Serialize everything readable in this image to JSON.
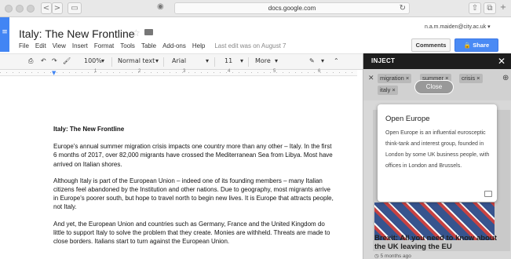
{
  "browser": {
    "url": "docs.google.com",
    "nav_back": "<",
    "nav_forward": ">",
    "reload_glyph": "↻",
    "lock_glyph": "◉"
  },
  "doc": {
    "title": "Italy: The New Frontline",
    "menu": [
      "File",
      "Edit",
      "View",
      "Insert",
      "Format",
      "Tools",
      "Table",
      "Add-ons",
      "Help"
    ],
    "last_edit": "Last edit was on August 7",
    "account": "n.a.m.maiden@city.ac.uk ▾",
    "comments_label": "Comments",
    "share_label": "Share",
    "toolbar": {
      "zoom": "100%",
      "style": "Normal text",
      "font": "Arial",
      "size": "11",
      "more": "More"
    },
    "ruler_numbers": [
      "1",
      "2",
      "3",
      "4",
      "5",
      "6"
    ],
    "heading": "Italy: The New Frontline",
    "paragraphs": [
      "Europe's annual summer migration crisis impacts one country more than any other – Italy. In the first 6 months of 2017, over 82,000 migrants have crossed the Mediterranean Sea from Libya. Most have arrived on Italian shores.",
      "Although Italy is part of the European Union – indeed one of its founding members – many Italian citizens feel abandoned by the Institution and other nations. Due to geography, most migrants arrive in Europe's poorer south, but hope to travel north to begin new lives. It is Europe that attracts people, not Italy.",
      "And yet, the European Union and countries such as Germany, France and the United Kingdom do little to support Italy to solve the problem that they create. Monies are withheld. Threats are made to close borders. Italians start to turn against the European Union."
    ]
  },
  "inject": {
    "title": "INJECT",
    "close_glyph": "✕",
    "tags": [
      "migration ×",
      "summer ×",
      "crisis ×",
      "italy ×"
    ],
    "close_button": "Close",
    "popup": {
      "title": "Open Europe",
      "body": "Open Europe is an influential eurosceptic think-tank and interest group, founded in London by some UK business people, with offices in London and Brussels."
    },
    "card_title": "Brexit: All you need to know about the UK leaving the EU",
    "card_time": "5 months ago"
  }
}
